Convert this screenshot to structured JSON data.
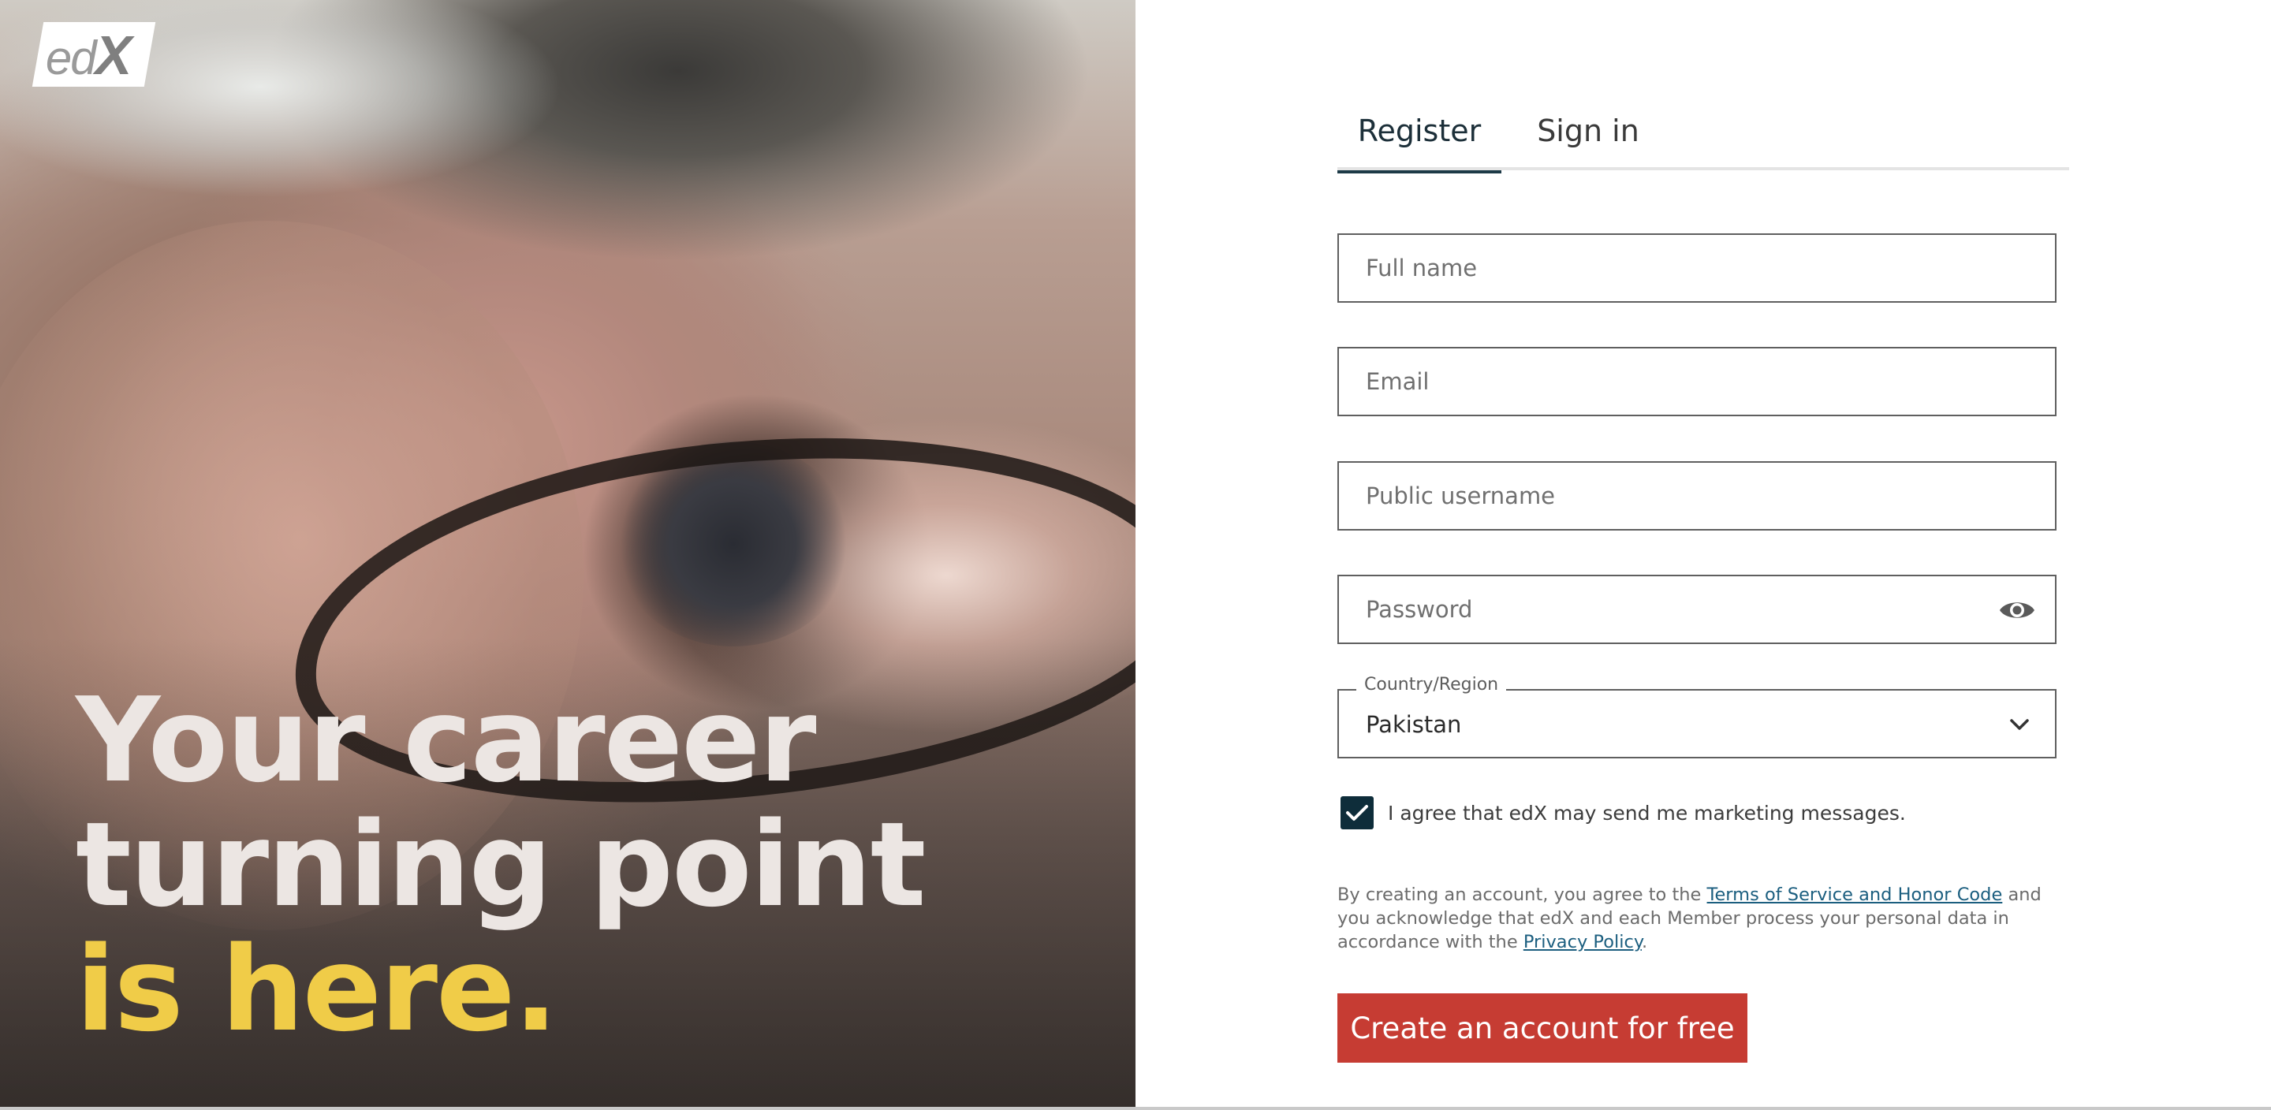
{
  "brand": {
    "logo_text_ed": "ed",
    "logo_text_x": "X"
  },
  "hero": {
    "headline_line1": "Your career",
    "headline_line2": "turning point",
    "headline_line3": "is here."
  },
  "tabs": [
    {
      "label": "Register",
      "active": true
    },
    {
      "label": "Sign in",
      "active": false
    }
  ],
  "form": {
    "full_name": {
      "placeholder": "Full name",
      "value": ""
    },
    "email": {
      "placeholder": "Email",
      "value": ""
    },
    "username": {
      "placeholder": "Public username",
      "value": ""
    },
    "password": {
      "placeholder": "Password",
      "value": ""
    },
    "country": {
      "label": "Country/Region",
      "value": "Pakistan"
    },
    "marketing": {
      "label": "I agree that edX may send me marketing messages.",
      "checked": true
    }
  },
  "legal": {
    "pre": "By creating an account, you agree to the ",
    "terms_link": "Terms of Service and Honor Code",
    "mid": " and you acknowledge that edX and each Member process your personal data in accordance with the ",
    "privacy_link": "Privacy Policy",
    "post": "."
  },
  "cta": {
    "label": "Create an account for free"
  },
  "colors": {
    "primary": "#0e2d3a",
    "cta": "#c63c33",
    "accent_yellow": "#f0cc48",
    "link": "#1b5e7f"
  },
  "icons": [
    "eye-icon",
    "chevron-down-icon",
    "checkmark-icon"
  ]
}
